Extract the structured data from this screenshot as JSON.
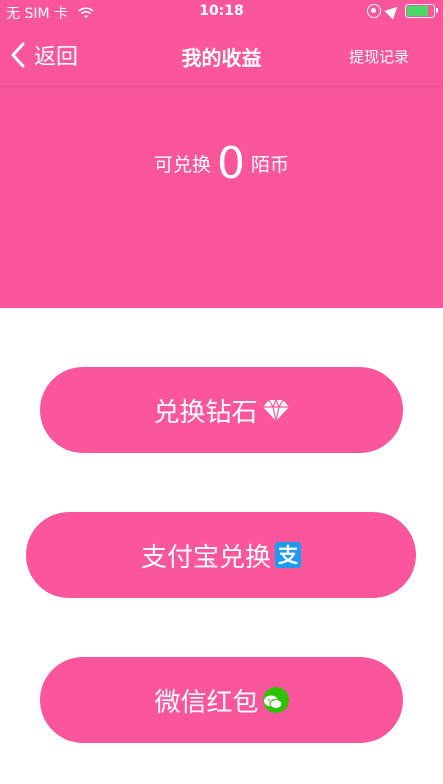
{
  "status_bar": {
    "carrier": "无 SIM 卡",
    "time": "10:18"
  },
  "nav": {
    "back_label": "返回",
    "title": "我的收益",
    "right_label": "提现记录"
  },
  "balance": {
    "prefix": "可兑换",
    "value": "0",
    "unit": "陌币"
  },
  "buttons": [
    {
      "label": "兑换钻石",
      "icon": "diamond-icon"
    },
    {
      "label": "支付宝兑换",
      "icon": "alipay-icon",
      "icon_text": "支"
    },
    {
      "label": "微信红包",
      "icon": "wechat-icon"
    }
  ],
  "colors": {
    "primary": "#fb559c",
    "battery": "#4cd964",
    "alipay": "#1d9bf0",
    "wechat": "#2dc100"
  },
  "battery_level": 0.75
}
